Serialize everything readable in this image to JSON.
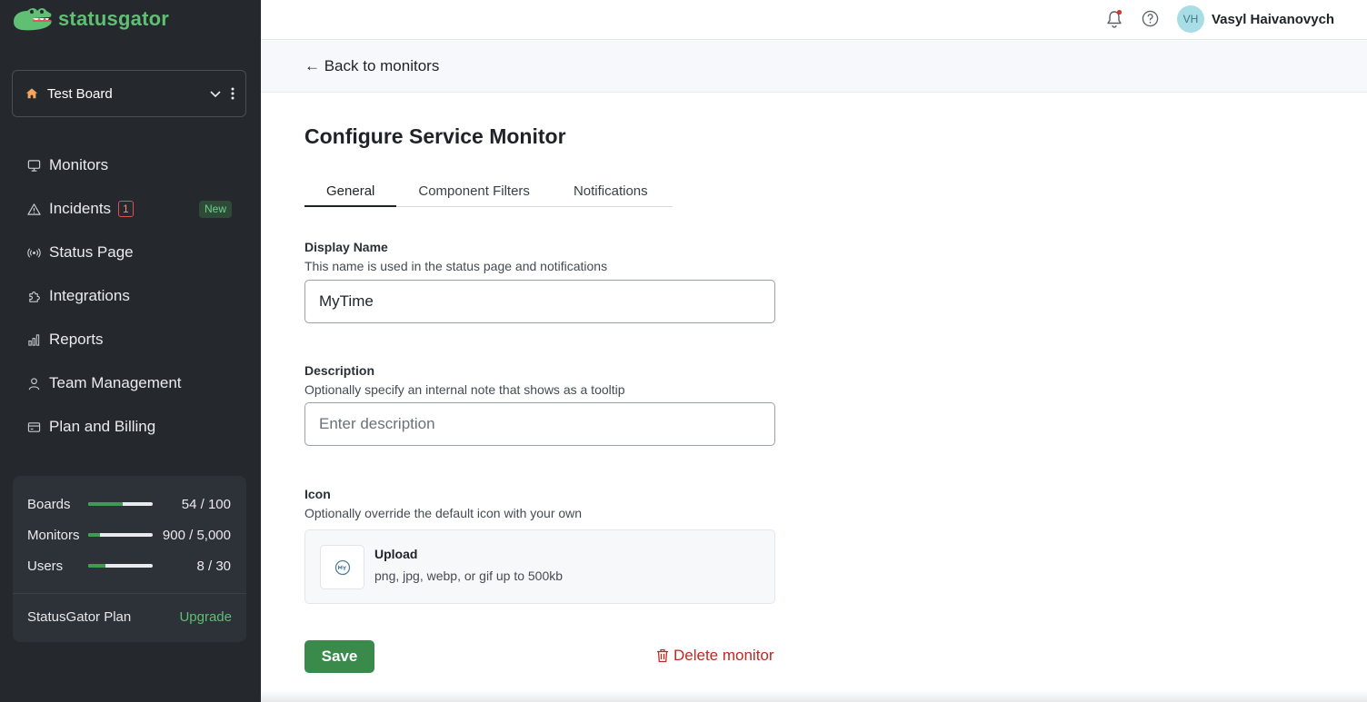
{
  "app": {
    "logo_text": "statusgator"
  },
  "board": {
    "name": "Test Board"
  },
  "sidebar": {
    "items": [
      {
        "label": "Monitors",
        "icon": "monitor-icon"
      },
      {
        "label": "Incidents",
        "icon": "alert-triangle-icon",
        "count": "1",
        "badge": "New"
      },
      {
        "label": "Status Page",
        "icon": "broadcast-icon"
      },
      {
        "label": "Integrations",
        "icon": "puzzle-icon"
      },
      {
        "label": "Reports",
        "icon": "bar-chart-icon"
      },
      {
        "label": "Team Management",
        "icon": "user-icon"
      },
      {
        "label": "Plan and Billing",
        "icon": "credit-card-icon"
      }
    ],
    "usage": [
      {
        "label": "Boards",
        "value": "54 / 100",
        "fraction": 0.54
      },
      {
        "label": "Monitors",
        "value": "900 / 5,000",
        "fraction": 0.18
      },
      {
        "label": "Users",
        "value": "8 / 30",
        "fraction": 0.27
      }
    ],
    "plan_label": "StatusGator Plan",
    "upgrade_label": "Upgrade"
  },
  "header": {
    "user_initials": "VH",
    "user_name": "Vasyl Haivanovych",
    "notification_dot": true
  },
  "back_link": "← Back to monitors",
  "page": {
    "title": "Configure Service Monitor",
    "tabs": [
      {
        "label": "General",
        "active": true
      },
      {
        "label": "Component Filters",
        "active": false
      },
      {
        "label": "Notifications",
        "active": false
      }
    ],
    "display_name": {
      "label": "Display Name",
      "help": "This name is used in the status page and notifications",
      "value": "MyTime"
    },
    "description": {
      "label": "Description",
      "help": "Optionally specify an internal note that shows as a tooltip",
      "value": "",
      "placeholder": "Enter description"
    },
    "icon": {
      "label": "Icon",
      "help": "Optionally override the default icon with your own",
      "upload_title": "Upload",
      "upload_help": "png, jpg, webp, or gif up to 500kb"
    },
    "save_label": "Save",
    "delete_label": "Delete monitor"
  },
  "colors": {
    "sidebar_bg": "#25292e",
    "brand_green": "#5fbf73",
    "save_green": "#3a8a4c",
    "danger_red": "#c0291f"
  }
}
